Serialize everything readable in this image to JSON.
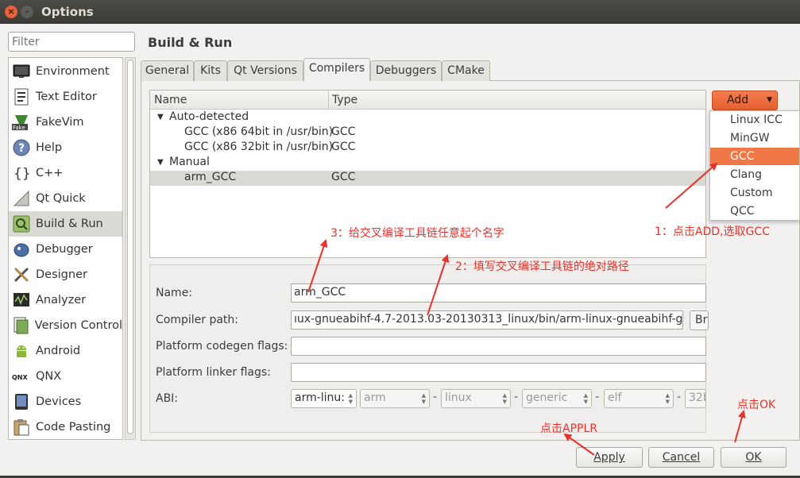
{
  "window": {
    "title": "Options",
    "close_glyph": "×",
    "min_glyph": "–"
  },
  "filter": {
    "placeholder": "Filter"
  },
  "sidebar": {
    "items": [
      {
        "label": "Environment",
        "icon": "monitor-icon"
      },
      {
        "label": "Text Editor",
        "icon": "text-editor-icon"
      },
      {
        "label": "FakeVim",
        "icon": "fakevim-icon"
      },
      {
        "label": "Help",
        "icon": "help-icon"
      },
      {
        "label": "C++",
        "icon": "braces-icon"
      },
      {
        "label": "Qt Quick",
        "icon": "qt-quick-icon"
      },
      {
        "label": "Build & Run",
        "icon": "build-run-icon",
        "selected": true
      },
      {
        "label": "Debugger",
        "icon": "debugger-icon"
      },
      {
        "label": "Designer",
        "icon": "designer-icon"
      },
      {
        "label": "Analyzer",
        "icon": "analyzer-icon"
      },
      {
        "label": "Version Control",
        "icon": "version-control-icon"
      },
      {
        "label": "Android",
        "icon": "android-icon"
      },
      {
        "label": "QNX",
        "icon": "qnx-icon"
      },
      {
        "label": "Devices",
        "icon": "devices-icon"
      },
      {
        "label": "Code Pasting",
        "icon": "code-pasting-icon"
      }
    ]
  },
  "page": {
    "title": "Build & Run"
  },
  "tabs": [
    "General",
    "Kits",
    "Qt Versions",
    "Compilers",
    "Debuggers",
    "CMake"
  ],
  "active_tab": "Compilers",
  "compiler_tree": {
    "headers": {
      "name": "Name",
      "type": "Type"
    },
    "rows": [
      {
        "name": "Auto-detected",
        "type": "",
        "expanded": true
      },
      {
        "name": "GCC (x86 64bit in /usr/bin)",
        "type": "GCC"
      },
      {
        "name": "GCC (x86 32bit in /usr/bin)",
        "type": "GCC"
      },
      {
        "name": "Manual",
        "type": "",
        "expanded": true
      },
      {
        "name": "arm_GCC",
        "type": "GCC",
        "selected": true
      }
    ]
  },
  "add_button": {
    "label": "Add"
  },
  "add_menu": {
    "items": [
      "Linux ICC",
      "MinGW",
      "GCC",
      "Clang",
      "Custom",
      "QCC"
    ],
    "highlighted": "GCC"
  },
  "form": {
    "name_label": "Name:",
    "name_value": "arm_GCC",
    "compiler_path_label": "Compiler path:",
    "compiler_path_value": "ıux-gnueabihf-4.7-2013.03-20130313_linux/bin/arm-linux-gnueabihf-g++",
    "browse_label": "Br",
    "codegen_label": "Platform codegen flags:",
    "codegen_value": "",
    "linker_label": "Platform linker flags:",
    "linker_value": "",
    "abi_label": "ABI:",
    "abi_values": [
      "arm-linu:",
      "arm",
      "linux",
      "generic",
      "elf",
      "32b"
    ],
    "abi_separator": "-"
  },
  "buttons": {
    "apply": "Apply",
    "cancel": "Cancel",
    "ok": "OK"
  },
  "annotations": {
    "step1": "1：点击ADD,选取GCC",
    "step2": "2：填写交叉编译工具链的绝对路径",
    "step3": "3：给交叉编译工具链任意起个名字",
    "apply_note": "点击APPLR",
    "ok_note": "点击OK",
    "color": "#e8322c"
  },
  "colors": {
    "accent": "#f07746",
    "selection": "#dbd9d3",
    "titlebar": "#3c3b37"
  }
}
